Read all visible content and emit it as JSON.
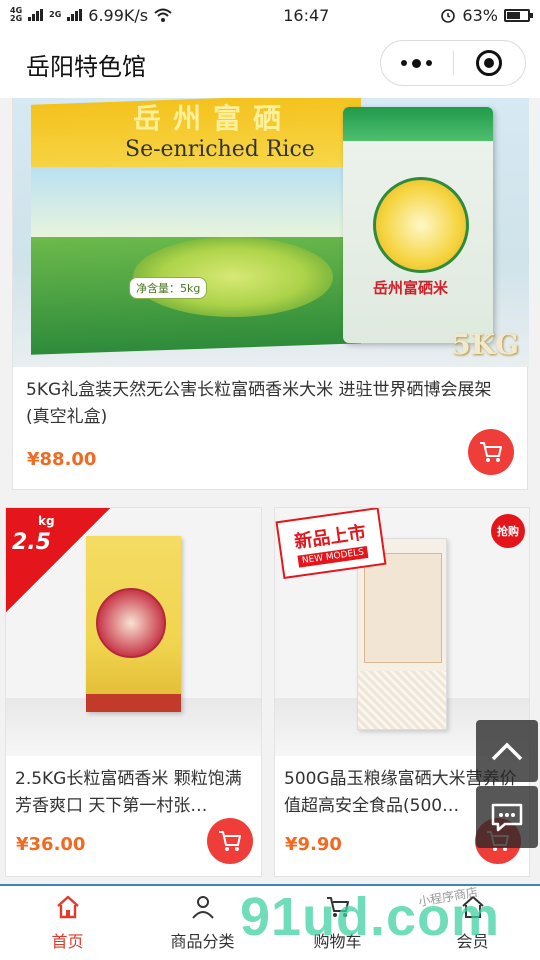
{
  "status_bar": {
    "network_top": "4G",
    "network_bottom": "2G",
    "network2": "2G",
    "speed": "6.99K/s",
    "time": "16:47",
    "battery": "63%",
    "battery_level": 0.63
  },
  "header": {
    "title": "岳阳特色馆"
  },
  "products": [
    {
      "title": "5KG礼盒装天然无公害长粒富硒香米大米 进驻世界硒博会展架 (真空礼盒)",
      "price": "¥88.00",
      "image": {
        "cn_top": "岳州富硒",
        "box_text": "Se-enriched Rice",
        "net_weight": "净含量：5kg",
        "bag_label": "岳州富硒米",
        "weight_tag": "5KG"
      }
    },
    {
      "title": "2.5KG长粒富硒香米 颗粒饱满芳香爽口 天下第一村张…",
      "price": "¥36.00",
      "image": {
        "badge": "2.5",
        "badge_unit": "kg"
      }
    },
    {
      "title": "500G晶玉粮缘富硒大米营养价值超高安全食品(500…",
      "price": "¥9.90",
      "image": {
        "new_tag": "新品上市",
        "new_tag_en": "NEW MODELS",
        "hot_tag": "抢购"
      }
    }
  ],
  "tabbar": {
    "items": [
      {
        "label": "首页",
        "icon": "home-icon",
        "active": true
      },
      {
        "label": "商品分类",
        "icon": "user-icon",
        "active": false
      },
      {
        "label": "购物车",
        "icon": "cart-icon",
        "active": false
      },
      {
        "label": "会员",
        "icon": "member-icon",
        "active": false
      }
    ]
  },
  "watermark": {
    "big": "91ud.com",
    "small": "小程序商店"
  },
  "colors": {
    "accent": "#ef3d3a",
    "price": "#f06a22",
    "tab_active": "#e23a2a"
  }
}
